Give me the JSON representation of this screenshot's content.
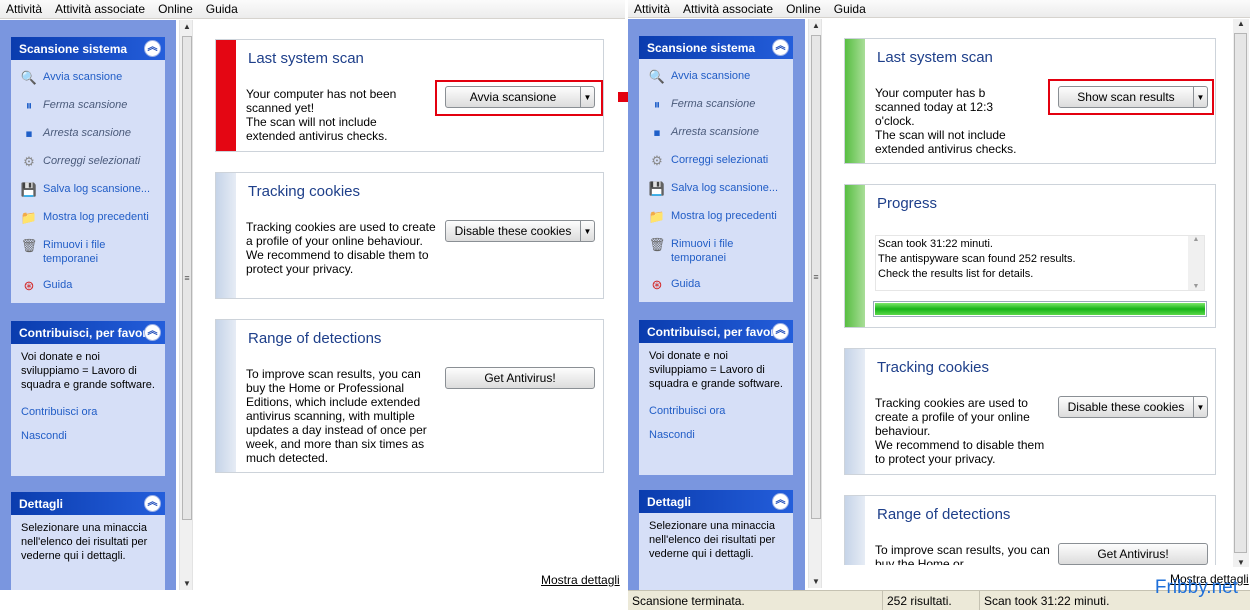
{
  "menu": [
    "Attività",
    "Attività associate",
    "Online",
    "Guida"
  ],
  "sidebar": {
    "scan_box": {
      "title": "Scansione sistema",
      "items": [
        {
          "label": "Avvia scansione",
          "icon": "magnifier-icon",
          "enabled": true
        },
        {
          "label": "Ferma scansione",
          "icon": "pause-icon",
          "enabled": false
        },
        {
          "label": "Arresta scansione",
          "icon": "stop-icon",
          "enabled": false
        },
        {
          "label": "Correggi selezionati",
          "icon": "gear-icon",
          "enabled": false
        },
        {
          "label": "Salva log scansione...",
          "icon": "floppy-icon",
          "enabled": true
        },
        {
          "label": "Mostra log precedenti",
          "icon": "folder-icon",
          "enabled": true
        },
        {
          "label": "Rimuovi i file temporanei",
          "icon": "trash-icon",
          "enabled": true
        },
        {
          "label": "Guida",
          "icon": "lifebuoy-icon",
          "enabled": true
        }
      ]
    },
    "contrib_box": {
      "title": "Contribuisci, per favore",
      "text": "Voi donate e noi sviluppiamo = Lavoro di squadra e grande software.",
      "link1": "Contribuisci ora",
      "link2": "Nascondi"
    },
    "details_box": {
      "title": "Dettagli",
      "text": "Selezionare una minaccia nell'elenco dei risultati per vederne qui i dettagli."
    }
  },
  "left": {
    "last_scan": {
      "title": "Last system scan",
      "text": "Your computer has not been scanned yet!\nThe scan will not include extended antivirus checks.",
      "button": "Avvia scansione"
    },
    "cookies": {
      "title": "Tracking cookies",
      "text": "Tracking cookies are used to create a profile of your online behaviour.\nWe recommend to disable them to protect your privacy.",
      "button": "Disable these cookies"
    },
    "range": {
      "title": "Range of detections",
      "text": "To improve scan results, you can buy the Home or Professional Editions, which include extended antivirus scanning, with multiple updates a day instead of once per week, and more than six times as much detected.",
      "button": "Get Antivirus!"
    },
    "details_link": "Mostra dettagli"
  },
  "right": {
    "last_scan": {
      "title": "Last system scan",
      "text": "Your computer has b\nscanned today at 12:3\no'clock.\nThe scan will not include extended antivirus checks.",
      "button": "Show scan results"
    },
    "progress": {
      "title": "Progress",
      "lines": "Scan took 31:22 minuti.\nThe antispyware scan found 252 results.\nCheck the results list for details.",
      "percent": 100
    },
    "cookies": {
      "title": "Tracking cookies",
      "text": "Tracking cookies are used to create a profile of your online behaviour.\nWe recommend to disable them to protect your privacy.",
      "button": "Disable these cookies"
    },
    "range": {
      "title": "Range of detections",
      "text": "To improve scan results, you can buy the Home or",
      "button": "Get Antivirus!"
    },
    "details_link": "Mostra dettagli",
    "status": [
      "Scansione terminata.",
      "252 risultati.",
      "Scan took 31:22 minuti."
    ]
  },
  "watermark": "Fribby.net",
  "colors": {
    "accent": "#e3000f",
    "header_blue": "#0a3cae",
    "link_blue": "#215dc6"
  }
}
